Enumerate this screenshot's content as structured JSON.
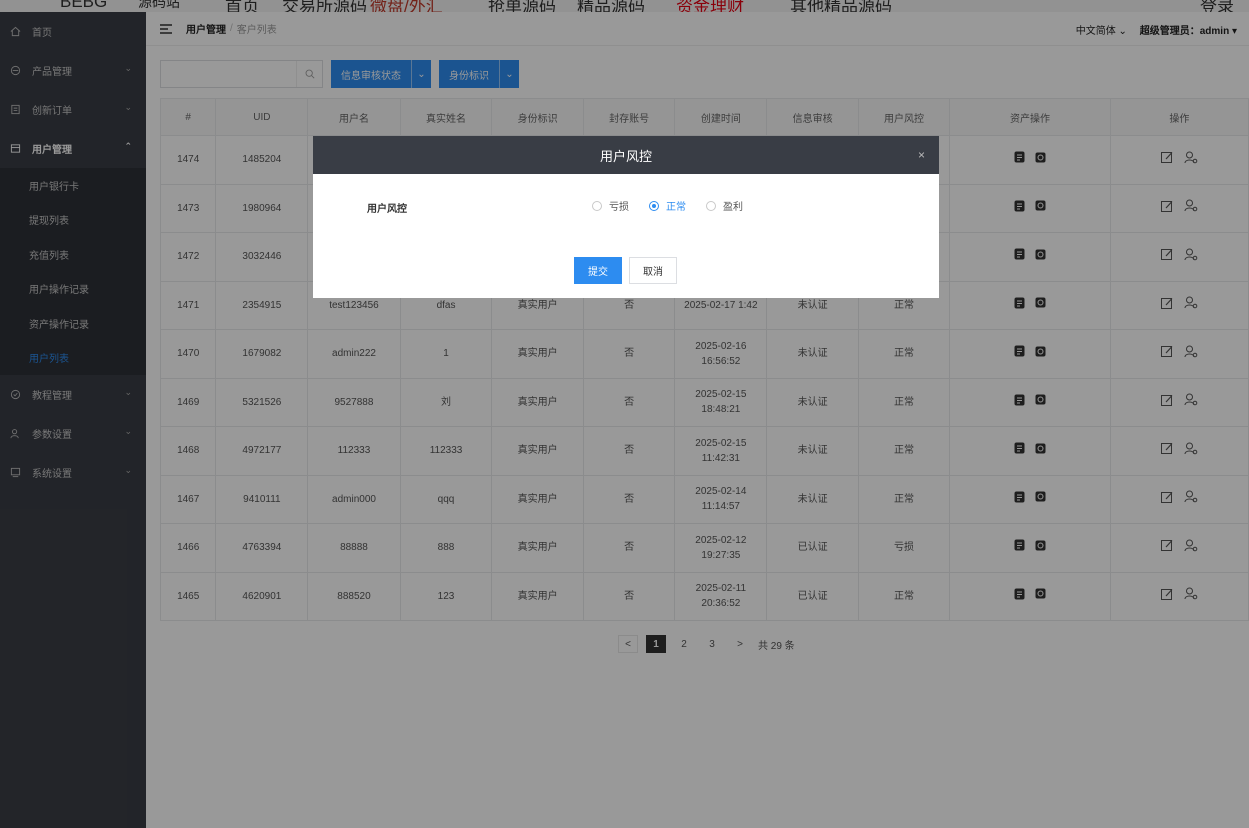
{
  "top_banner": {
    "items": [
      "源码站",
      "首页",
      "交易所源码",
      "微盘/外汇",
      "抢单源码",
      "精品源码",
      "资金理财",
      "其他精品源码",
      "登录"
    ]
  },
  "sidebar": {
    "items": [
      {
        "label": "首页",
        "icon": "home-icon"
      },
      {
        "label": "产品管理",
        "icon": "product-icon"
      },
      {
        "label": "创新订单",
        "icon": "order-icon"
      },
      {
        "label": "用户管理",
        "icon": "user-manage-icon"
      },
      {
        "label": "教程管理",
        "icon": "tutorial-icon"
      },
      {
        "label": "参数设置",
        "icon": "params-icon"
      },
      {
        "label": "系统设置",
        "icon": "system-icon"
      }
    ],
    "sub_items": [
      "用户银行卡",
      "提现列表",
      "充值列表",
      "用户操作记录",
      "资产操作记录",
      "用户列表"
    ],
    "active_color": "#2d8cf0"
  },
  "header": {
    "breadcrumb_parent": "用户管理",
    "breadcrumb_sep": "/",
    "breadcrumb_current": "客户列表",
    "language": "中文简体",
    "admin": "超级管理员：admin"
  },
  "toolbar": {
    "search_placeholder": "",
    "filter1": "信息审核状态",
    "filter2": "身份标识"
  },
  "table": {
    "headers": [
      "#",
      "UID",
      "用户名",
      "真实姓名",
      "身份标识",
      "封存账号",
      "创建时间",
      "信息审核",
      "用户风控",
      "资产操作",
      "操作"
    ],
    "rows": [
      [
        "1474",
        "1485204",
        "",
        "",
        "",
        "",
        "",
        "",
        "",
        "",
        ""
      ],
      [
        "1473",
        "1980964",
        "",
        "",
        "",
        "",
        "",
        "",
        "",
        "",
        ""
      ],
      [
        "1472",
        "3032446",
        "",
        "",
        "",
        "",
        "",
        "",
        "",
        "",
        ""
      ],
      [
        "1471",
        "2354915",
        "test123456",
        "dfas",
        "真实用户",
        "否",
        "2025-02-17 1:42",
        "未认证",
        "正常",
        "",
        ""
      ],
      [
        "1470",
        "1679082",
        "admin222",
        "1",
        "真实用户",
        "否",
        "2025-02-16 16:56:52",
        "未认证",
        "正常",
        "",
        ""
      ],
      [
        "1469",
        "5321526",
        "9527888",
        "刘",
        "真实用户",
        "否",
        "2025-02-15 18:48:21",
        "未认证",
        "正常",
        "",
        ""
      ],
      [
        "1468",
        "4972177",
        "112333",
        "112333",
        "真实用户",
        "否",
        "2025-02-15 11:42:31",
        "未认证",
        "正常",
        "",
        ""
      ],
      [
        "1467",
        "9410111",
        "admin000",
        "qqq",
        "真实用户",
        "否",
        "2025-02-14 11:14:57",
        "未认证",
        "正常",
        "",
        ""
      ],
      [
        "1466",
        "4763394",
        "88888",
        "888",
        "真实用户",
        "否",
        "2025-02-12 19:27:35",
        "已认证",
        "亏损",
        "",
        ""
      ],
      [
        "1465",
        "4620901",
        "888520",
        "123",
        "真实用户",
        "否",
        "2025-02-11 20:36:52",
        "已认证",
        "正常",
        "",
        ""
      ]
    ]
  },
  "pagination": {
    "prev": "<",
    "pages": [
      "1",
      "2",
      "3"
    ],
    "current": "1",
    "next": ">",
    "total": "共 29 条"
  },
  "modal": {
    "title": "用户风控",
    "close": "×",
    "field_label": "用户风控",
    "options": [
      "亏损",
      "正常",
      "盈利"
    ],
    "selected": "正常",
    "submit": "提交",
    "cancel": "取消"
  }
}
